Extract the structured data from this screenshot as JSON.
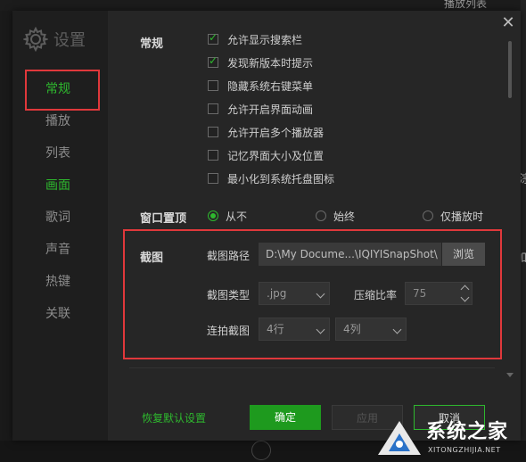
{
  "background": {
    "top_right_text": "播放列表",
    "side_text_1": "淙",
    "side_text_2": "加"
  },
  "dialog": {
    "title": "设置",
    "icons": {
      "settings": "gear-icon",
      "close": "close-icon"
    },
    "colors": {
      "accent": "#2eb82e",
      "highlight": "#e0383b",
      "ok_button": "#1e9a1e"
    },
    "sidebar": {
      "items": [
        {
          "label": "常规",
          "state": "active"
        },
        {
          "label": "播放"
        },
        {
          "label": "列表"
        },
        {
          "label": "画面",
          "state": "green"
        },
        {
          "label": "歌词"
        },
        {
          "label": "声音"
        },
        {
          "label": "热键"
        },
        {
          "label": "关联"
        }
      ]
    },
    "general": {
      "section_label": "常规",
      "options": [
        {
          "label": "允许显示搜索栏",
          "checked": true
        },
        {
          "label": "发现新版本时提示",
          "checked": true
        },
        {
          "label": "隐藏系统右键菜单",
          "checked": false
        },
        {
          "label": "允许开启界面动画",
          "checked": false
        },
        {
          "label": "允许开启多个播放器",
          "checked": false
        },
        {
          "label": "记忆界面大小及位置",
          "checked": false
        },
        {
          "label": "最小化到系统托盘图标",
          "checked": false
        }
      ]
    },
    "window_topmost": {
      "label": "窗口置顶",
      "options": [
        {
          "label": "从不",
          "selected": true
        },
        {
          "label": "始终",
          "selected": false
        },
        {
          "label": "仅播放时",
          "selected": false
        }
      ]
    },
    "screenshot": {
      "section_label": "截图",
      "path_label": "截图路径",
      "path_value": "D:\\My Docume...\\IQIYISnapShot\\",
      "browse_label": "浏览",
      "type_label": "截图类型",
      "type_value": ".jpg",
      "ratio_label": "压缩比率",
      "ratio_value": "75",
      "burst_label": "连拍截图",
      "rows_value": "4行",
      "cols_value": "4列"
    },
    "footer": {
      "restore_label": "恢复默认设置",
      "ok_label": "确定",
      "apply_label": "应用",
      "cancel_label": "取消"
    }
  },
  "watermark": {
    "text": "系统之家",
    "url": "XITONGZHIJIA.NET"
  }
}
